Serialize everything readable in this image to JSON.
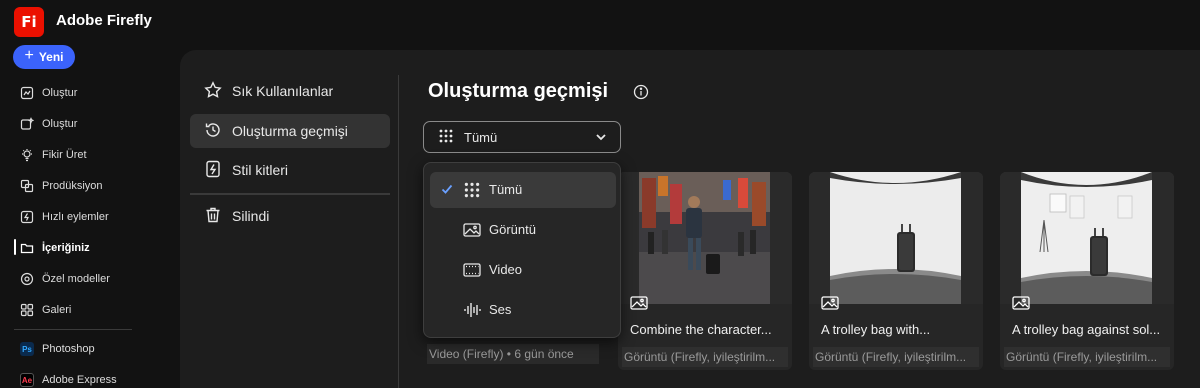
{
  "app": {
    "logo_text": "Fi",
    "title": "Adobe Firefly",
    "brand_color": "#eb1000",
    "accent_color": "#3b63fb"
  },
  "new_button": {
    "label": "Yeni",
    "icon": "plus-icon"
  },
  "leftnav": {
    "items": [
      {
        "label": "Oluştur",
        "icon": "create-icon"
      },
      {
        "label": "Oluştur",
        "icon": "generate-icon"
      },
      {
        "label": "Fikir Üret",
        "icon": "ideate-icon"
      },
      {
        "label": "Prodüksiyon",
        "icon": "production-icon"
      },
      {
        "label": "Hızlı eylemler",
        "icon": "quick-actions-icon"
      },
      {
        "label": "İçeriğiniz",
        "icon": "folder-icon",
        "active": true
      },
      {
        "label": "Özel modeller",
        "icon": "custom-models-icon"
      },
      {
        "label": "Galeri",
        "icon": "gallery-icon"
      }
    ],
    "apps": [
      {
        "label": "Photoshop",
        "icon": "photoshop-icon",
        "icon_text": "Ps"
      },
      {
        "label": "Adobe Express",
        "icon": "adobe-express-icon",
        "icon_text": "Ae"
      }
    ]
  },
  "subnav": {
    "items": [
      {
        "label": "Sık Kullanılanlar",
        "icon": "star-icon"
      },
      {
        "label": "Oluşturma geçmişi",
        "icon": "history-icon",
        "selected": true
      },
      {
        "label": "Stil kitleri",
        "icon": "style-kit-icon"
      },
      {
        "label": "Silindi",
        "icon": "trash-icon"
      }
    ]
  },
  "main": {
    "title": "Oluşturma geçmişi",
    "filter": {
      "selected": "Tümü",
      "options": [
        {
          "label": "Tümü",
          "icon": "grid-icon",
          "selected": true
        },
        {
          "label": "Görüntü",
          "icon": "image-icon"
        },
        {
          "label": "Video",
          "icon": "video-icon"
        },
        {
          "label": "Ses",
          "icon": "audio-icon"
        }
      ]
    },
    "cards": [
      {
        "caption": "",
        "meta": "Video (Firefly) • 6 gün önce"
      },
      {
        "caption": "Combine the character...",
        "meta": "Görüntü (Firefly, iyileştirilm..."
      },
      {
        "caption": "A trolley bag with...",
        "meta": "Görüntü (Firefly, iyileştirilm..."
      },
      {
        "caption": "A trolley bag against sol...",
        "meta": "Görüntü (Firefly, iyileştirilm..."
      }
    ]
  }
}
